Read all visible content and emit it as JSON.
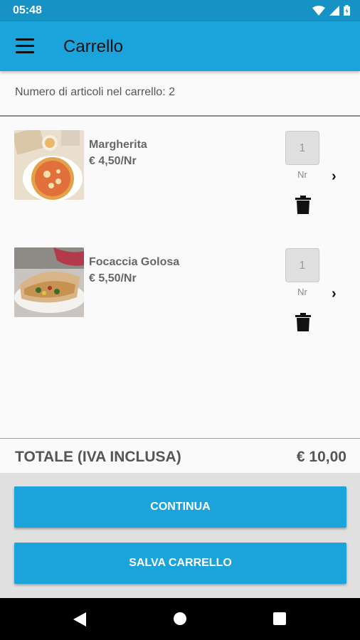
{
  "status_bar": {
    "time": "05:48"
  },
  "app_bar": {
    "title": "Carrello"
  },
  "cart": {
    "count_text": "Numero di articoli nel carrello: 2",
    "items": [
      {
        "name": "Margherita",
        "price": "€ 4,50/Nr",
        "quantity": "1",
        "unit": "Nr"
      },
      {
        "name": "Focaccia Golosa",
        "price": "€ 5,50/Nr",
        "quantity": "1",
        "unit": "Nr"
      }
    ],
    "total_label": "TOTALE (IVA INCLUSA)",
    "total_value": "€ 10,00"
  },
  "buttons": {
    "continue": "CONTINUA",
    "save": "SALVA CARRELLO"
  },
  "colors": {
    "primary": "#1ba3dc",
    "status_bar": "#1692c4"
  }
}
